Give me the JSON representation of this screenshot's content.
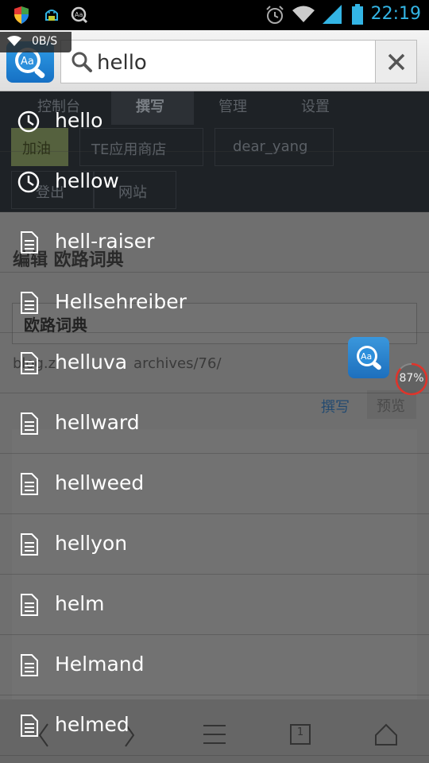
{
  "status_bar": {
    "time": "22:19",
    "net_speed": "0B/S",
    "icons": [
      "shield-icon",
      "android-debug-icon",
      "dict-icon",
      "alarm-icon",
      "wifi-icon",
      "signal-icon",
      "battery-icon"
    ]
  },
  "app": {
    "logo": "Aa",
    "search": {
      "value": "hello"
    },
    "clear_icon": "close-icon"
  },
  "suggestions": [
    {
      "label": "hello",
      "type": "history"
    },
    {
      "label": "hellow",
      "type": "history"
    },
    {
      "label": "hell-raiser",
      "type": "word"
    },
    {
      "label": "Hellsehreiber",
      "type": "word"
    },
    {
      "label": "helluva",
      "type": "word"
    },
    {
      "label": "hellward",
      "type": "word"
    },
    {
      "label": "hellweed",
      "type": "word"
    },
    {
      "label": "hellyon",
      "type": "word"
    },
    {
      "label": "helm",
      "type": "word"
    },
    {
      "label": "Helmand",
      "type": "word"
    },
    {
      "label": "helmed",
      "type": "word"
    }
  ],
  "background_page": {
    "nav": [
      "控制台",
      "撰写",
      "管理",
      "设置"
    ],
    "buttons": [
      "加油",
      "TE应用商店",
      "dear_yang",
      "登出",
      "网站"
    ],
    "edit_title": "编辑 欧路词典",
    "title_value": "欧路词典",
    "url": "blog.z",
    "url_tail": "archives/76/",
    "tab_write": "撰写",
    "tab_preview": "预览"
  },
  "float_widget": {
    "logo": "Aa",
    "progress_text": "87%",
    "progress": 0.87,
    "ring_color": "#e0342b"
  },
  "bottom_nav": {
    "tab_count": "1",
    "icons": [
      "back-icon",
      "forward-icon",
      "menu-icon",
      "tabs-icon",
      "home-icon"
    ]
  },
  "colors": {
    "clock": "#33b5e5",
    "logo": "#1e86d6"
  }
}
